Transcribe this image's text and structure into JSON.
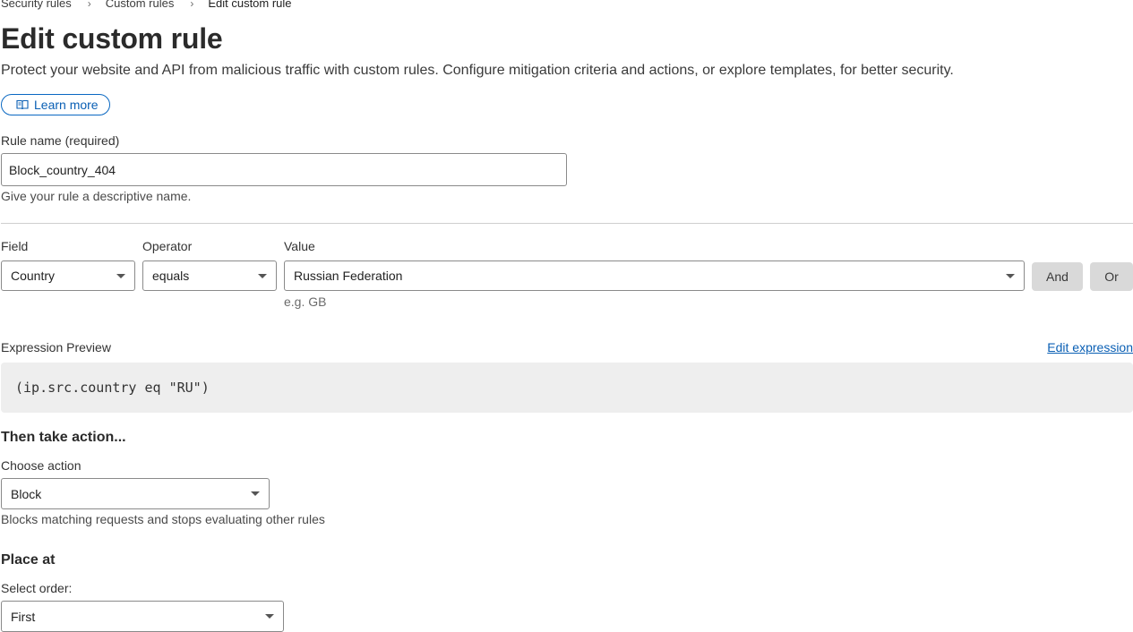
{
  "breadcrumb": {
    "items": [
      "Security rules",
      "Custom rules"
    ],
    "current": "Edit custom rule"
  },
  "header": {
    "title": "Edit custom rule",
    "description": "Protect your website and API from malicious traffic with custom rules. Configure mitigation criteria and actions, or explore templates, for better security.",
    "learn_more_label": "Learn more"
  },
  "rule_name": {
    "label": "Rule name (required)",
    "value": "Block_country_404",
    "hint": "Give your rule a descriptive name."
  },
  "condition": {
    "field_label": "Field",
    "field_value": "Country",
    "operator_label": "Operator",
    "operator_value": "equals",
    "value_label": "Value",
    "value_value": "Russian Federation",
    "value_hint": "e.g. GB",
    "and_label": "And",
    "or_label": "Or"
  },
  "expression": {
    "label": "Expression Preview",
    "edit_label": "Edit expression",
    "text": "(ip.src.country eq \"RU\")"
  },
  "action": {
    "title": "Then take action...",
    "label": "Choose action",
    "value": "Block",
    "hint": "Blocks matching requests and stops evaluating other rules"
  },
  "placement": {
    "title": "Place at",
    "label": "Select order:",
    "value": "First"
  },
  "icons": {
    "breadcrumb_separator": "chevron-right-icon",
    "learn_more": "book-icon",
    "dropdown": "caret-down-icon"
  },
  "colors": {
    "link": "#0a5fb4",
    "button_gray": "#d9d9d9",
    "expression_bg": "#eeeeee"
  }
}
